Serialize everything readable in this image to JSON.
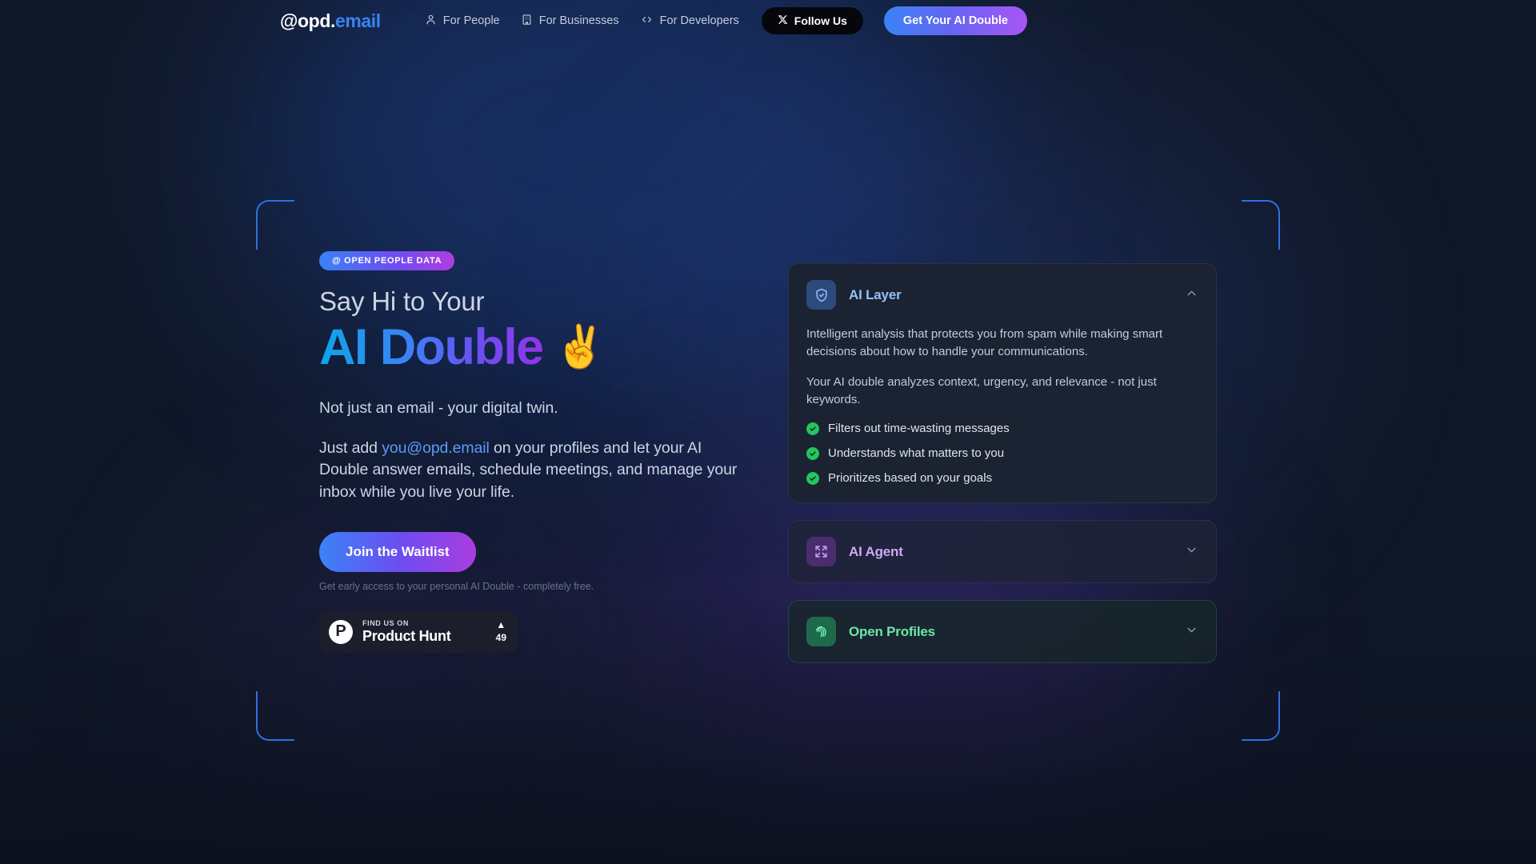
{
  "header": {
    "logo": {
      "white": "@opd.",
      "blue": "email"
    },
    "nav": [
      {
        "label": "For People",
        "icon": "person-icon"
      },
      {
        "label": "For Businesses",
        "icon": "building-icon"
      },
      {
        "label": "For Developers",
        "icon": "code-icon"
      }
    ],
    "follow_label": "Follow Us",
    "cta_label": "Get Your AI Double"
  },
  "hero": {
    "badge": "@ OPEN PEOPLE DATA",
    "title_line1": "Say Hi to Your",
    "title_line2": "AI Double",
    "emoji": "✌️",
    "lead": "Not just an email - your digital twin.",
    "paragraph_before": "Just add ",
    "paragraph_link": "you@opd.email",
    "paragraph_after": " on your profiles and let your AI Double answer emails, schedule meetings, and manage your inbox while you live your life.",
    "cta_label": "Join the Waitlist",
    "note": "Get early access to your personal AI Double - completely free.",
    "product_hunt": {
      "eyebrow": "FIND US ON",
      "name": "Product Hunt",
      "logo_letter": "P",
      "arrow": "▲",
      "count": "49"
    }
  },
  "accordion": [
    {
      "title": "AI Layer",
      "icon": "shield-check-icon",
      "state": "expanded",
      "chevron": "chevron-up-icon",
      "paragraphs": [
        "Intelligent analysis that protects you from spam while making smart decisions about how to handle your communications.",
        "Your AI double analyzes context, urgency, and relevance - not just keywords."
      ],
      "features": [
        "Filters out time-wasting messages",
        "Understands what matters to you",
        "Prioritizes based on your goals"
      ]
    },
    {
      "title": "AI Agent",
      "icon": "expand-arrows-icon",
      "state": "collapsed",
      "chevron": "chevron-down-icon"
    },
    {
      "title": "Open Profiles",
      "icon": "fingerprint-icon",
      "state": "collapsed",
      "chevron": "chevron-down-icon"
    }
  ],
  "colors": {
    "background": "#101828",
    "accent_blue": "#3b82f6",
    "accent_purple": "#a855f7",
    "accent_green": "#22c55e",
    "link_blue": "#5b9bf5"
  }
}
